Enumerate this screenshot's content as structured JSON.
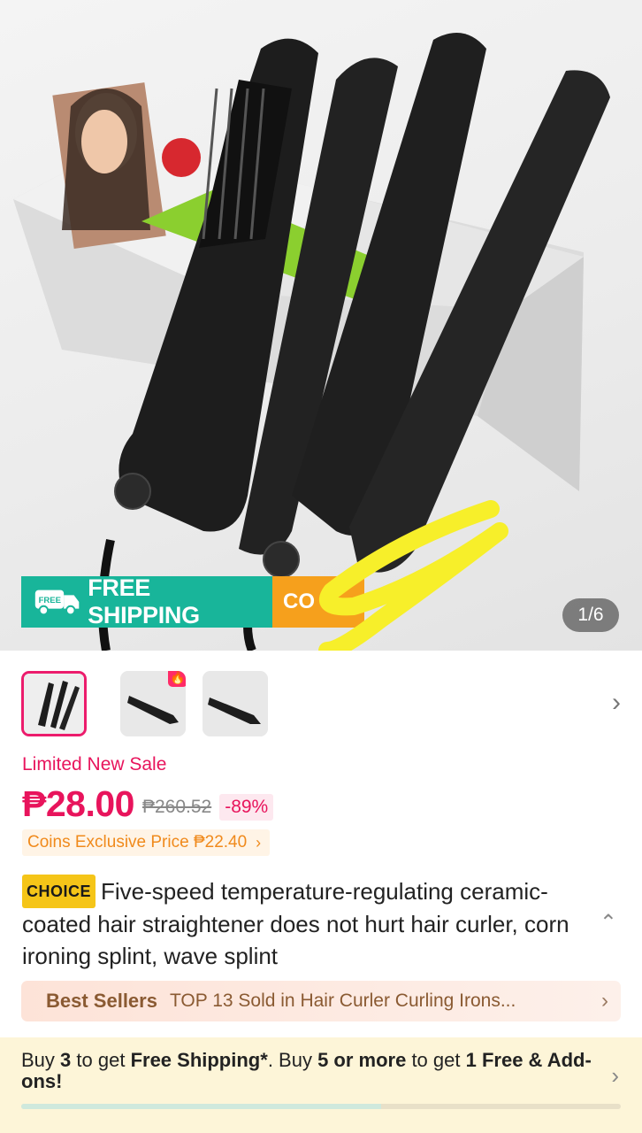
{
  "hero": {
    "free_shipping_label": "FREE SHIPPING",
    "truck_badge": "FREE",
    "secondary_badge": "CO",
    "page_counter": "1/6",
    "annotation_color": "#f7ef2a",
    "photo_alt": "Black hair straighteners in front of product box"
  },
  "thumbnails": {
    "items": [
      {
        "name": "thumb-1",
        "active": true
      },
      {
        "name": "thumb-2",
        "active": false,
        "badge": "fire-icon"
      },
      {
        "name": "thumb-3",
        "active": false
      }
    ],
    "next_icon": "chevron-right-icon"
  },
  "pricing": {
    "sale_label": "Limited New Sale",
    "price_now": "₱28.00",
    "price_old": "₱260.52",
    "discount": "-89%",
    "coins_text": "Coins Exclusive Price ₱22.40",
    "accent_color": "#e8145c"
  },
  "product": {
    "choice_badge": "CHOICE",
    "title": "Five-speed temperature-regulating ceramic-coated hair straightener does not hurt hair curler, corn ironing splint, wave splint"
  },
  "best_sellers": {
    "tag": "Best Sellers",
    "text": "TOP 13 Sold in Hair Curler Curling Irons..."
  },
  "promo": {
    "p1": "Buy ",
    "q1": "3",
    "p2": " to get ",
    "b1": "Free Shipping*",
    "p3": ". Buy ",
    "q2": "5 or more",
    "p4": "  to get ",
    "b2": "1 Free & Add-ons!",
    "progress": 0.6
  }
}
